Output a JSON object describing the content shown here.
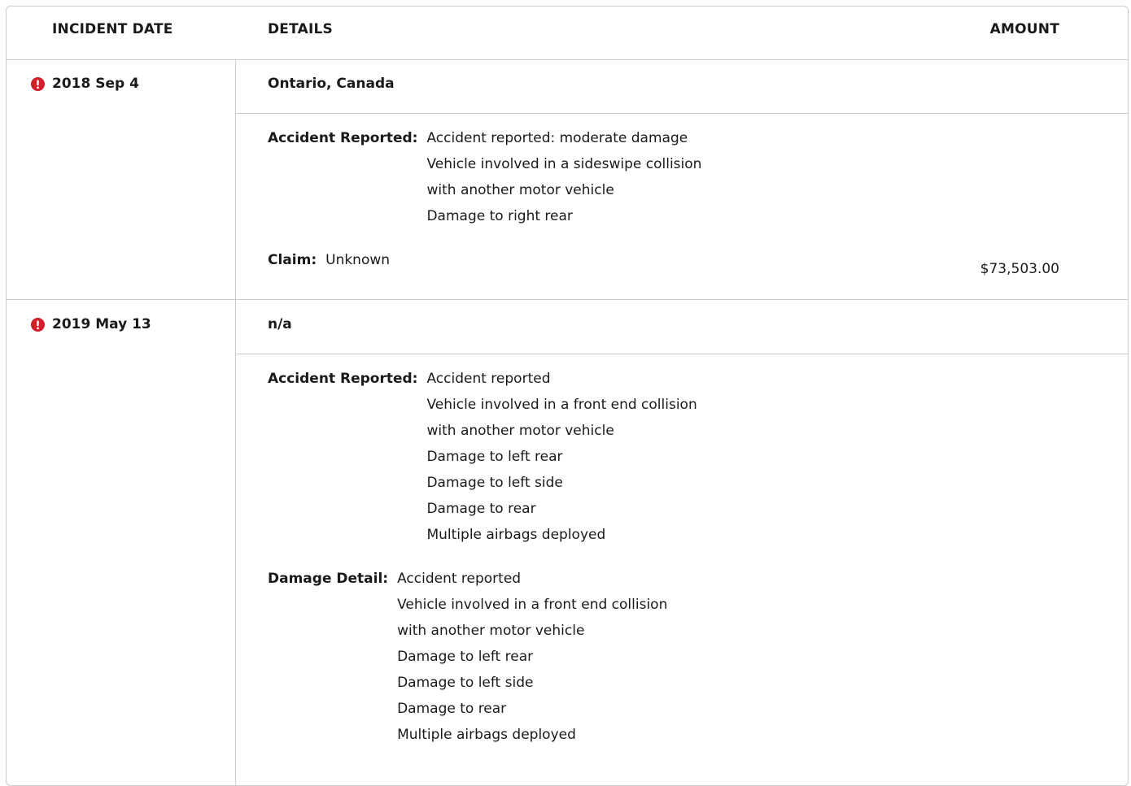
{
  "table": {
    "headers": {
      "date": "INCIDENT DATE",
      "details": "DETAILS",
      "amount": "AMOUNT"
    },
    "alert_color": "#d0202a",
    "incidents": [
      {
        "date": "2018 Sep 4",
        "location": "Ontario, Canada",
        "accident_label": "Accident Reported:",
        "accident_lines": [
          "Accident reported: moderate damage",
          "Vehicle involved in a sideswipe collision",
          "with another motor vehicle",
          "Damage to right rear"
        ],
        "claim_label": "Claim:",
        "claim_value": "Unknown",
        "amount": "$73,503.00"
      },
      {
        "date": "2019 May 13",
        "location": "n/a",
        "accident_label": "Accident Reported:",
        "accident_lines": [
          "Accident reported",
          "Vehicle involved in a front end collision",
          "with another motor vehicle",
          "Damage to left rear",
          "Damage to left side",
          "Damage to rear",
          "Multiple airbags deployed"
        ],
        "damage_label": "Damage Detail:",
        "damage_lines": [
          "Accident reported",
          "Vehicle involved in a front end collision",
          "with another motor vehicle",
          "Damage to left rear",
          "Damage to left side",
          "Damage to rear",
          "Multiple airbags deployed"
        ]
      }
    ]
  }
}
